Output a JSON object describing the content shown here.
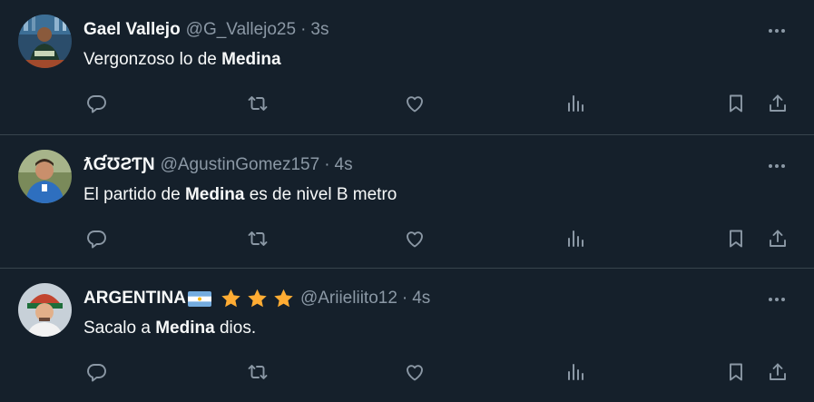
{
  "tweets": [
    {
      "name": "Gael Vallejo",
      "handle": "@G_Vallejo25",
      "separator": "·",
      "time": "3s",
      "text_before": "Vergonzoso lo de ",
      "text_bold": "Medina",
      "text_after": ""
    },
    {
      "name": "ƛƓƱƧƬƝ",
      "handle": "@AgustinGomez157",
      "separator": "·",
      "time": "4s",
      "text_before": "El partido de ",
      "text_bold": "Medina",
      "text_after": " es de nivel B metro"
    },
    {
      "name": "ARGENTINA",
      "name_emoji": [
        "argentina-flag",
        "star",
        "star",
        "star"
      ],
      "handle": "@Ariieliito12",
      "separator": "·",
      "time": "4s",
      "text_before": "Sacalo a ",
      "text_bold": "Medina",
      "text_after": " dios."
    }
  ],
  "action_icons": [
    "reply-icon",
    "retweet-icon",
    "like-icon",
    "views-icon",
    "bookmark-icon",
    "share-icon"
  ],
  "colors": {
    "background": "#15202b",
    "text": "#f7f9f9",
    "secondary": "#8b98a5",
    "divider": "#38444d",
    "star": "#ffac33"
  }
}
